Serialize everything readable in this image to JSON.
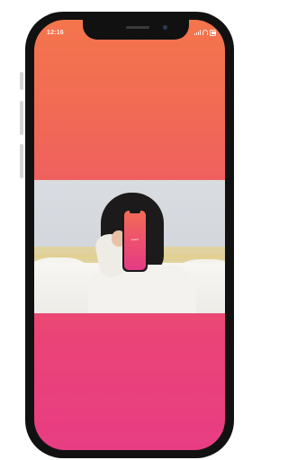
{
  "status_bar": {
    "time": "12:16",
    "icons": [
      "signal-icon",
      "wifi-icon",
      "battery-icon"
    ]
  },
  "screen": {
    "gradient_colors": [
      "#f4754c",
      "#ee5867",
      "#e83d83"
    ],
    "photo": {
      "subject": "person-holding-phone",
      "mini_phone_label": "splash"
    }
  }
}
